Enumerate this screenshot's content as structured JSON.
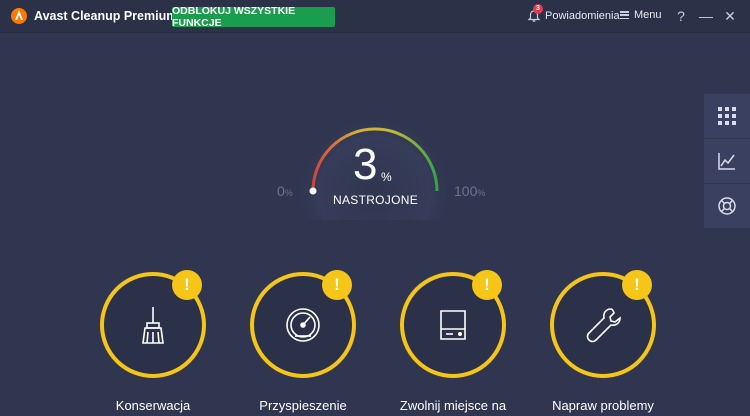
{
  "titlebar": {
    "app_title": "Avast Cleanup Premium",
    "unlock_label": "ODBLOKUJ WSZYSTKIE FUNKCJE",
    "notifications_label": "Powiadomienia",
    "notifications_count": "3",
    "menu_label": "Menu",
    "help_symbol": "?",
    "minimize_symbol": "—",
    "close_symbol": "✕"
  },
  "gauge": {
    "value": "3",
    "unit": "%",
    "label": "NASTROJONE",
    "min_label": "0",
    "max_label": "100",
    "level": 0.03
  },
  "side_panel": {
    "icons": [
      "grid-icon",
      "chart-icon",
      "lifebuoy-icon"
    ]
  },
  "tiles": [
    {
      "label": "Konserwacja",
      "icon": "broom-icon",
      "warning": "!"
    },
    {
      "label": "Przyspieszenie",
      "icon": "speedometer-icon",
      "warning": "!"
    },
    {
      "label": "Zwolnij miejsce na",
      "icon": "hard-drive-icon",
      "warning": "!"
    },
    {
      "label": "Napraw problemy",
      "icon": "wrench-icon",
      "warning": "!"
    }
  ],
  "colors": {
    "background": "#30364f",
    "titlebar": "#2b3147",
    "accent_green": "#1a9e4d",
    "warning_yellow": "#f5c518",
    "badge_red": "#e53b4f"
  }
}
